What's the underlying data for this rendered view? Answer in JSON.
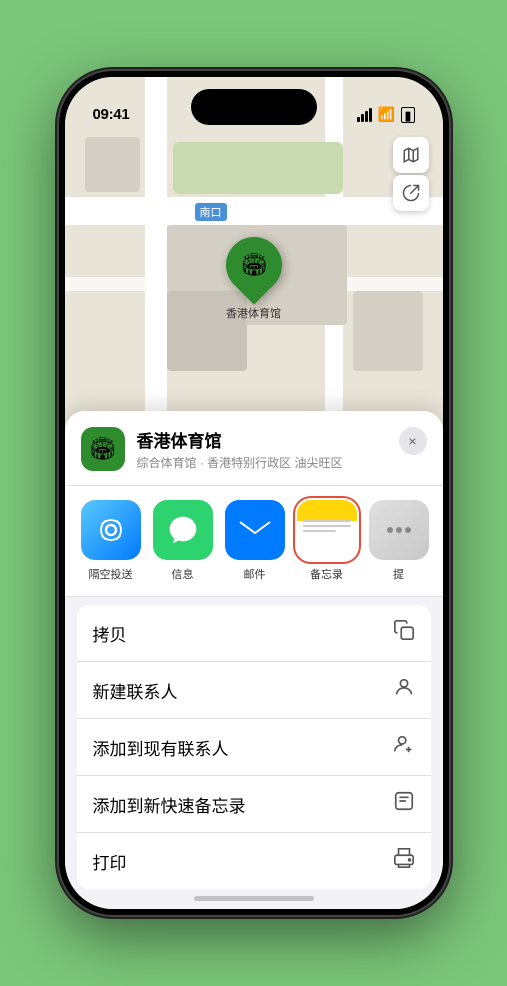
{
  "status_bar": {
    "time": "09:41",
    "location_arrow": "▶"
  },
  "map": {
    "label_nankou": "南口"
  },
  "venue": {
    "name": "香港体育馆",
    "subtitle": "综合体育馆 · 香港特别行政区 油尖旺区",
    "pin_label": "香港体育馆",
    "close_label": "×"
  },
  "share_items": [
    {
      "id": "airdrop",
      "label": "隔空投送",
      "type": "airdrop"
    },
    {
      "id": "messages",
      "label": "信息",
      "type": "messages"
    },
    {
      "id": "mail",
      "label": "邮件",
      "type": "mail"
    },
    {
      "id": "notes",
      "label": "备忘录",
      "type": "notes"
    },
    {
      "id": "more",
      "label": "提",
      "type": "more"
    }
  ],
  "actions": [
    {
      "label": "拷贝",
      "icon": "📋"
    },
    {
      "label": "新建联系人",
      "icon": "👤"
    },
    {
      "label": "添加到现有联系人",
      "icon": "👤"
    },
    {
      "label": "添加到新快速备忘录",
      "icon": "🗒"
    },
    {
      "label": "打印",
      "icon": "🖨"
    }
  ]
}
